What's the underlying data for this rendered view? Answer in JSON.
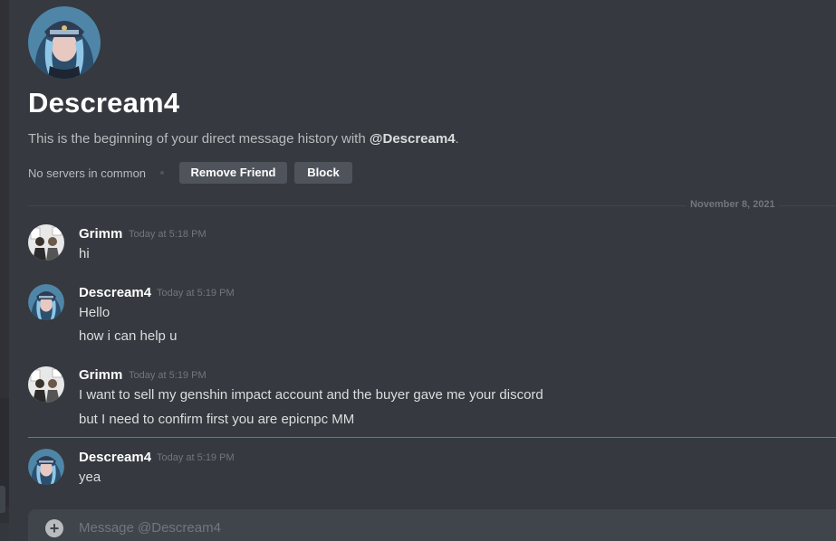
{
  "profile": {
    "name": "Descream4",
    "intro_prefix": "This is the beginning of your direct message history with ",
    "intro_handle": "@Descream4",
    "intro_suffix": ".",
    "mutual_servers": "No servers in common",
    "remove_friend_label": "Remove Friend",
    "block_label": "Block"
  },
  "date_divider": "November 8, 2021",
  "messages": [
    {
      "author": "Grimm",
      "timestamp": "Today at 5:18 PM",
      "lines": [
        "hi"
      ],
      "avatar": "grimm-avatar"
    },
    {
      "author": "Descream4",
      "timestamp": "Today at 5:19 PM",
      "lines": [
        "Hello",
        "how i can help u"
      ],
      "avatar": "descream4-avatar"
    },
    {
      "author": "Grimm",
      "timestamp": "Today at 5:19 PM",
      "lines": [
        "I want to sell my genshin impact account and the buyer gave me your discord",
        "but I need to confirm first you are epicnpc MM"
      ],
      "avatar": "grimm-avatar"
    },
    {
      "author": "Descream4",
      "timestamp": "Today at 5:19 PM",
      "lines": [
        "yea"
      ],
      "avatar": "descream4-avatar"
    }
  ],
  "composer": {
    "placeholder": "Message @Descream4",
    "add_icon": "plus-circle-icon"
  },
  "colors": {
    "background": "#36393f",
    "button": "#4f545c",
    "new_messages_line": "#ed4245",
    "username": "#ffffff",
    "timestamp": "#72767d"
  }
}
